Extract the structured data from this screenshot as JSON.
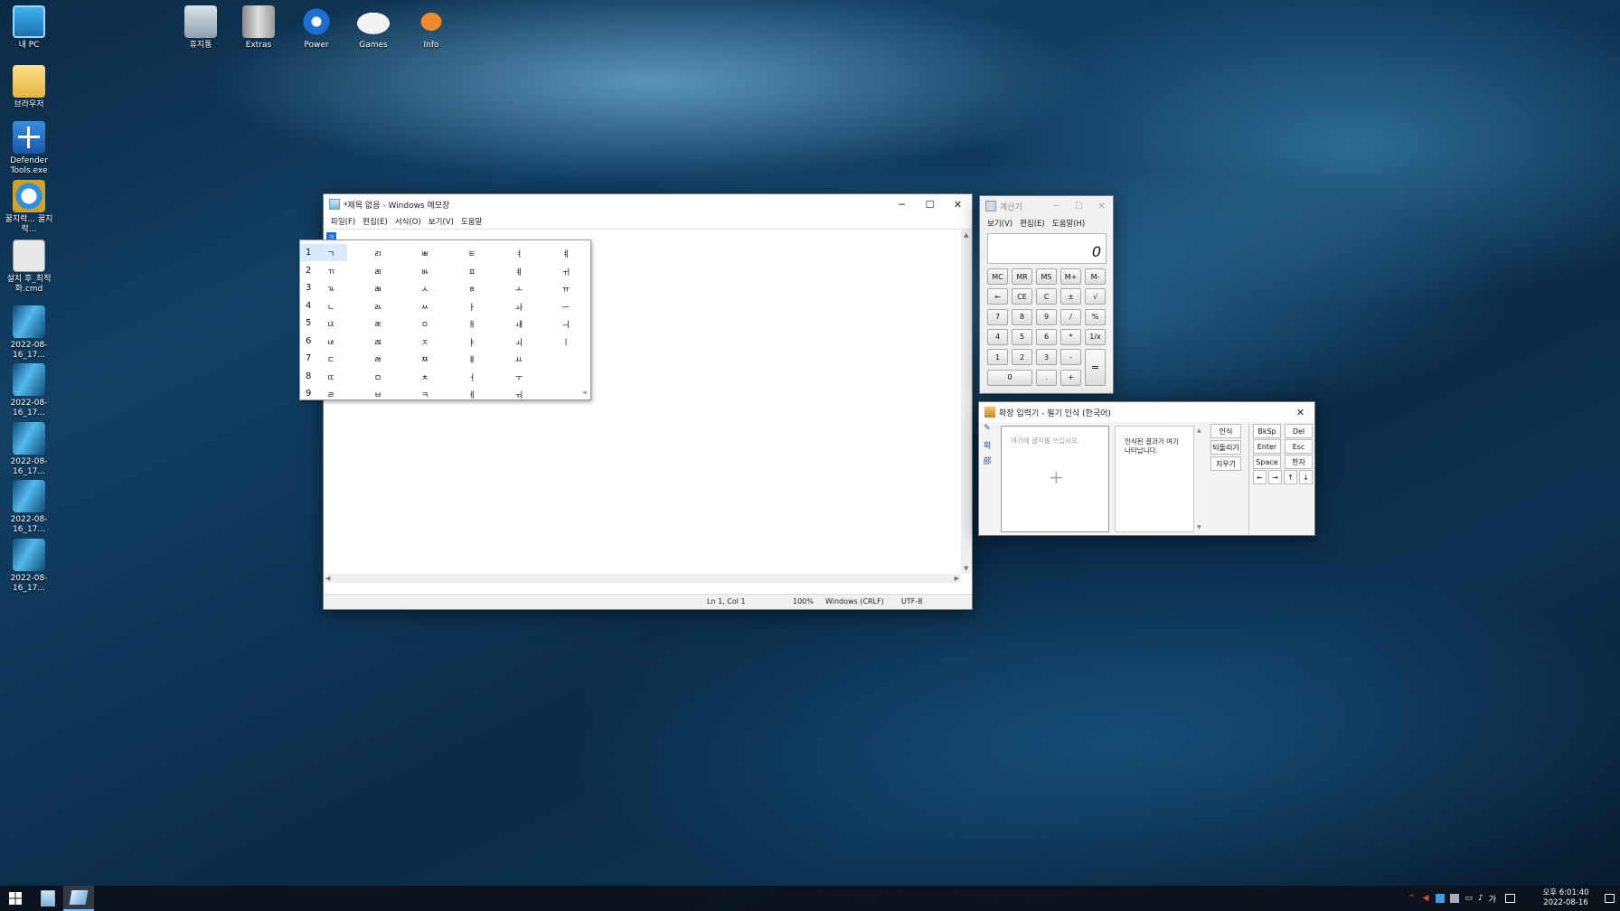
{
  "desktop": {
    "icons": [
      {
        "label": "내 PC",
        "icon": "monitor-icon"
      },
      {
        "label": "브라우저",
        "icon": "folder-icon"
      },
      {
        "label": "Defender Tools.exe",
        "icon": "shield-icon"
      },
      {
        "label": "꿀지락... 꿀지락...",
        "icon": "ie-icon"
      },
      {
        "label": "설치 후_최적화.cmd",
        "icon": "gear-icon"
      },
      {
        "label": "2022-08-16_17...",
        "icon": "screenshot-icon"
      },
      {
        "label": "2022-08-16_17...",
        "icon": "screenshot-icon"
      },
      {
        "label": "2022-08-16_17...",
        "icon": "screenshot-icon"
      },
      {
        "label": "2022-08-16_17...",
        "icon": "screenshot-icon"
      },
      {
        "label": "2022-08-16_17...",
        "icon": "screenshot-icon"
      }
    ],
    "top_icons": [
      {
        "label": "휴지통",
        "icon": "recycle-bin-icon"
      },
      {
        "label": "Extras",
        "icon": "book-icon"
      },
      {
        "label": "Power",
        "icon": "power-icon"
      },
      {
        "label": "Games",
        "icon": "gamepad-icon"
      },
      {
        "label": "Info",
        "icon": "bird-icon"
      }
    ]
  },
  "notepad": {
    "title": "*제목 없음 - Windows 메모장",
    "menu": [
      "파일(F)",
      "편집(E)",
      "서식(O)",
      "보기(V)",
      "도움말"
    ],
    "caret_char": "ㅋ",
    "status": {
      "position": "Ln 1, Col 1",
      "zoom": "100%",
      "eol": "Windows (CRLF)",
      "encoding": "UTF-8"
    },
    "controls": {
      "minimize": "─",
      "maximize": "☐",
      "close": "✕"
    }
  },
  "candidates": {
    "rows": [
      {
        "num": "1",
        "cells": [
          "ㄱ",
          "ㄺ",
          "ㅃ",
          "ㅌ",
          "ㅕ",
          "ㅖ"
        ]
      },
      {
        "num": "2",
        "cells": [
          "ㄲ",
          "ㄻ",
          "ㅄ",
          "ㅍ",
          "ㅖ",
          "ㅟ"
        ]
      },
      {
        "num": "3",
        "cells": [
          "ㄳ",
          "ㄼ",
          "ㅅ",
          "ㅎ",
          "ㅗ",
          "ㅠ"
        ]
      },
      {
        "num": "4",
        "cells": [
          "ㄴ",
          "ㄽ",
          "ㅆ",
          "ㅏ",
          "ㅘ",
          "ㅡ"
        ]
      },
      {
        "num": "5",
        "cells": [
          "ㄵ",
          "ㄾ",
          "ㅇ",
          "ㅐ",
          "ㅙ",
          "ㅢ"
        ]
      },
      {
        "num": "6",
        "cells": [
          "ㄶ",
          "ㄿ",
          "ㅈ",
          "ㅑ",
          "ㅚ",
          "ㅣ"
        ]
      },
      {
        "num": "7",
        "cells": [
          "ㄷ",
          "ㅀ",
          "ㅉ",
          "ㅒ",
          "ㅛ",
          ""
        ]
      },
      {
        "num": "8",
        "cells": [
          "ㄸ",
          "ㅁ",
          "ㅊ",
          "ㅓ",
          "ㅜ",
          ""
        ]
      },
      {
        "num": "9",
        "cells": [
          "ㄹ",
          "ㅂ",
          "ㅋ",
          "ㅔ",
          "ㅝ",
          ""
        ]
      }
    ],
    "collapse": "«"
  },
  "calculator": {
    "title": "계산기",
    "menu": [
      "보기(V)",
      "편집(E)",
      "도움말(H)"
    ],
    "display": "0",
    "keys": [
      [
        "MC",
        "MR",
        "MS",
        "M+",
        "M-"
      ],
      [
        "←",
        "CE",
        "C",
        "±",
        "√"
      ],
      [
        "7",
        "8",
        "9",
        "/",
        "%"
      ],
      [
        "4",
        "5",
        "6",
        "*",
        "1/x"
      ],
      [
        "1",
        "2",
        "3",
        "-"
      ],
      [
        "0",
        ".",
        "+"
      ]
    ],
    "equals": "=",
    "controls": {
      "minimize": "─",
      "maximize": "☐",
      "close": "✕"
    }
  },
  "handwriting": {
    "title": "확장 입력기 - 필기 인식 (한국어)",
    "side": [
      "✎",
      "획",
      "部"
    ],
    "placeholder": "여기에 글자를 쓰십시오.",
    "result_text": "인식된 결과가 여기 나타납니다.",
    "actions": [
      "인식",
      "되돌리기",
      "지우기"
    ],
    "keys": [
      "BkSp",
      "Del",
      "Enter",
      "Esc",
      "Space",
      "한자"
    ],
    "arrows": [
      "←",
      "→",
      "↑",
      "↓"
    ],
    "close": "✕"
  },
  "taskbar": {
    "tray": [
      "^",
      "가"
    ],
    "time": "오후 6:01:40",
    "date": "2022-08-16"
  }
}
